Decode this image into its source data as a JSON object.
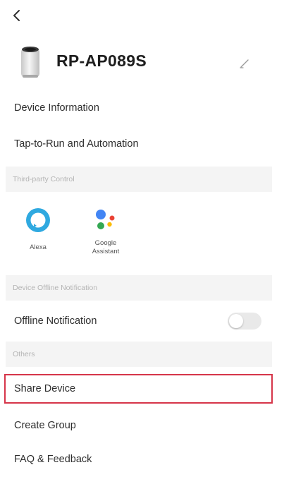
{
  "device": {
    "name": "RP-AP089S"
  },
  "menu": {
    "device_information": "Device Information",
    "tap_to_run": "Tap-to-Run and Automation",
    "offline_notification": "Offline Notification",
    "share_device": "Share Device",
    "create_group": "Create Group",
    "faq_feedback": "FAQ & Feedback"
  },
  "sections": {
    "third_party": "Third-party Control",
    "offline_notifications": "Device Offline Notification",
    "others": "Others"
  },
  "assistants": [
    {
      "label": "Alexa",
      "icon": "alexa-icon"
    },
    {
      "label": "Google Assistant",
      "icon": "google-assistant-icon"
    }
  ],
  "offline_notification_enabled": false,
  "colors": {
    "highlight": "#d63549",
    "alexa": "#2fa9e0",
    "section_bg": "#f4f4f4"
  }
}
